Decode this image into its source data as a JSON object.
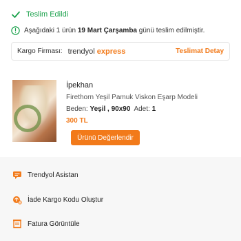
{
  "status": {
    "label": "Teslim Edildi",
    "color": "#1aa14b"
  },
  "delivery_info": {
    "prefix": "Aşağıdaki 1 ürün",
    "date": "19 Mart Çarşamba",
    "suffix": "günü teslim edilmiştir."
  },
  "cargo": {
    "label": "Kargo Firması:",
    "brand_part1": "trendyol",
    "brand_part2": "express",
    "detail_link": "Teslimat Detay"
  },
  "product": {
    "seller": "İpekhan",
    "name": "Firethorn Yeşil Pamuk Viskon Eşarp Modeli",
    "size_label": "Beden:",
    "size_value": "Yeşil , 90x90",
    "qty_label": "Adet:",
    "qty_value": "1",
    "price": "300 TL",
    "rate_button": "Ürünü Değerlendir"
  },
  "menu": [
    {
      "label": "Trendyol Asistan",
      "icon": "chat-icon"
    },
    {
      "label": "İade Kargo Kodu Oluştur",
      "icon": "return-cargo-icon"
    },
    {
      "label": "Fatura Görüntüle",
      "icon": "invoice-icon"
    }
  ],
  "colors": {
    "accent": "#f27a1a",
    "success": "#1aa14b"
  }
}
